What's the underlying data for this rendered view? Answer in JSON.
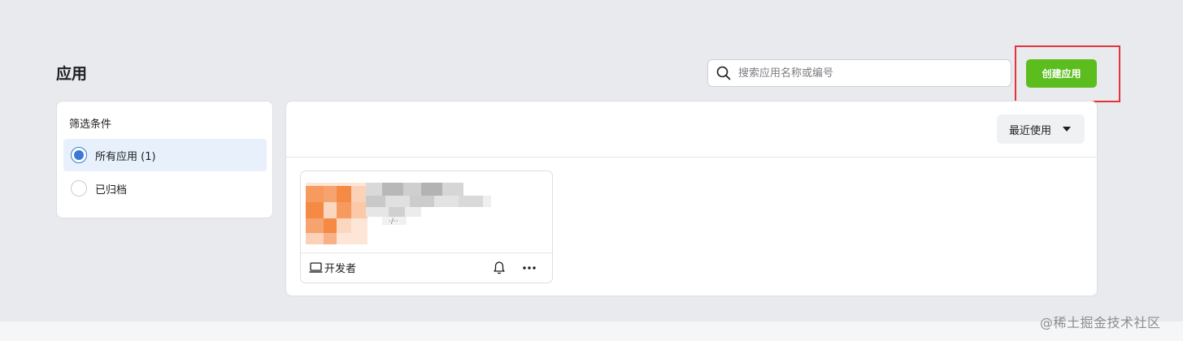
{
  "page": {
    "title": "应用"
  },
  "search": {
    "placeholder": "搜索应用名称或编号",
    "value": ""
  },
  "toolbar": {
    "create_label": "创建应用"
  },
  "filters": {
    "title": "筛选条件",
    "options": [
      {
        "label": "所有应用 (1)",
        "selected": true
      },
      {
        "label": "已归档",
        "selected": false
      }
    ]
  },
  "sort": {
    "label": "最近使用"
  },
  "apps": [
    {
      "role": "开发者",
      "icons": {
        "role": "laptop-icon",
        "notify": "bell-icon",
        "more": "more-icon"
      }
    }
  ],
  "watermark": "@稀土掘金技术社区",
  "colors": {
    "accent_green": "#5cbd1f",
    "radio_blue": "#3b79d6",
    "highlight_red": "#e0353c",
    "selected_bg": "#e7f0fb"
  }
}
